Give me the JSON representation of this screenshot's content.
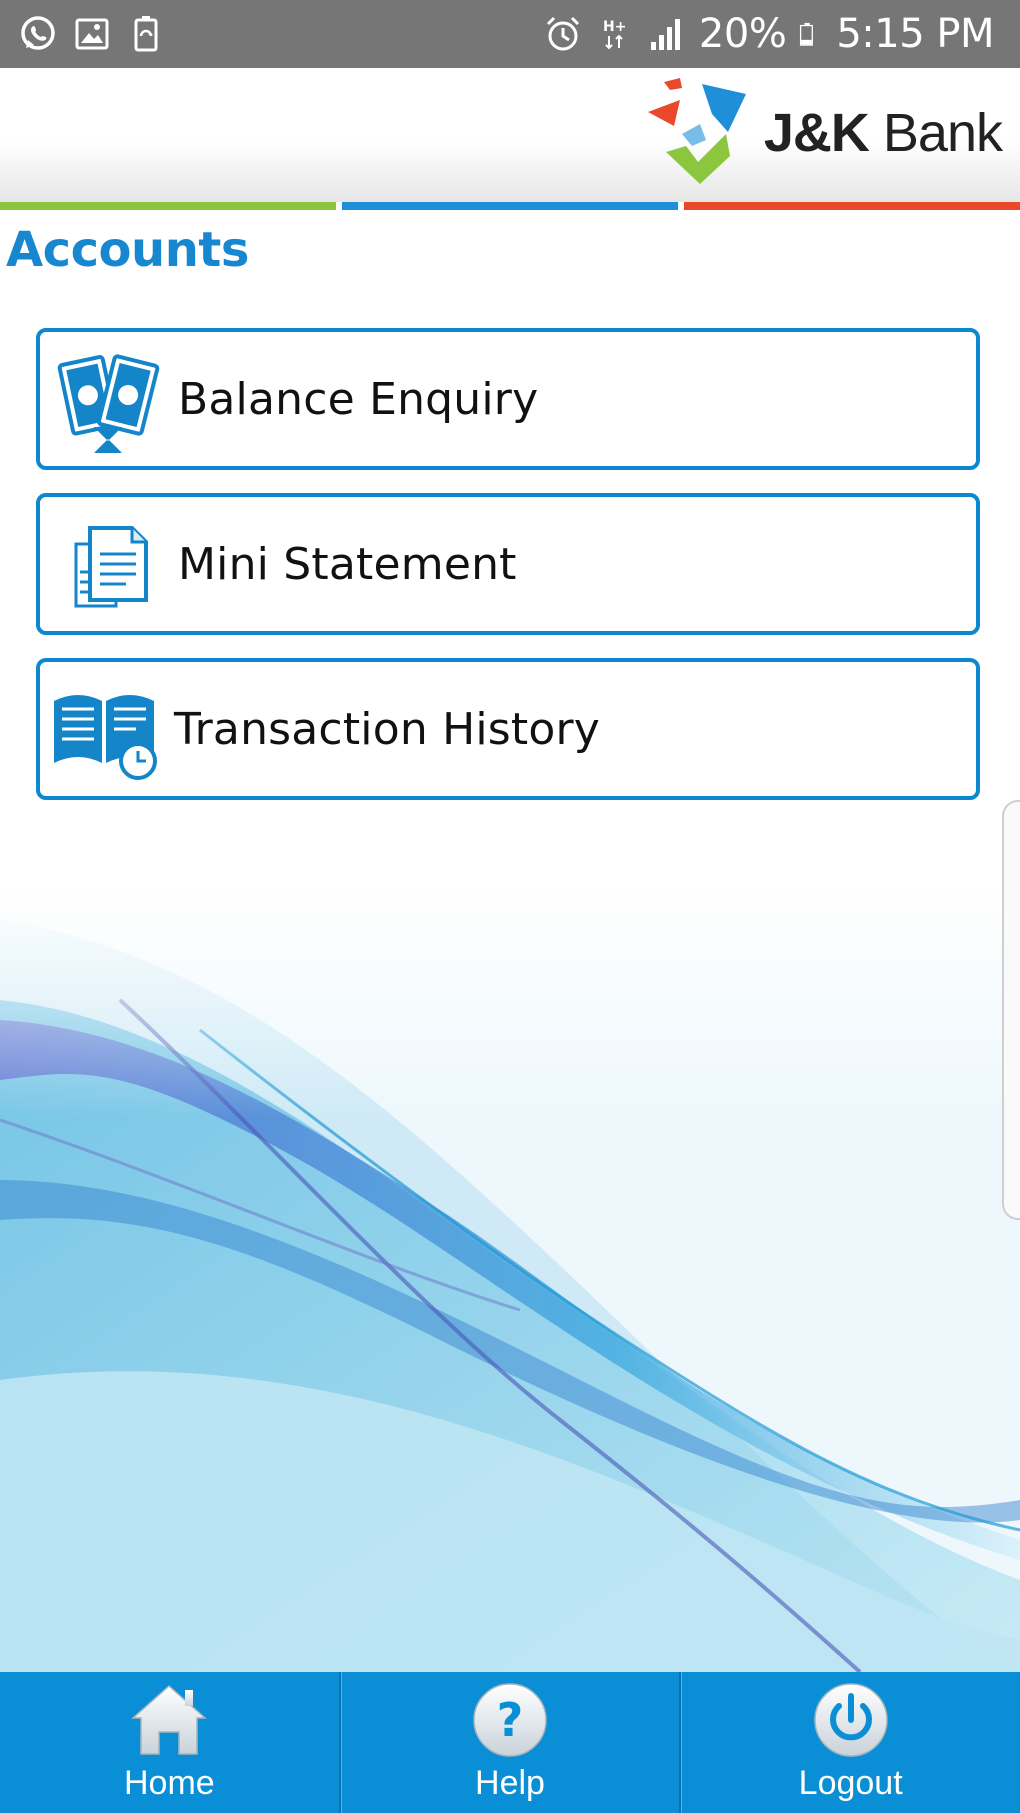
{
  "status_bar": {
    "battery": "20%",
    "time": "5:15 PM",
    "icons": [
      "whatsapp-icon",
      "gallery-icon",
      "battery-saver-icon",
      "alarm-icon",
      "hplus-network-icon",
      "signal-icon",
      "battery-icon"
    ]
  },
  "header": {
    "brand_bold": "J&K",
    "brand_light": " Bank",
    "stripe_colors": [
      "#8cc63f",
      "#1e8fd8",
      "#e9482b"
    ]
  },
  "page": {
    "title": "Accounts"
  },
  "menu": {
    "items": [
      {
        "label": "Balance Enquiry",
        "icon": "money-balance-icon"
      },
      {
        "label": "Mini Statement",
        "icon": "document-icon"
      },
      {
        "label": "Transaction History",
        "icon": "book-clock-icon"
      }
    ]
  },
  "bottom_nav": {
    "items": [
      {
        "label": "Home",
        "icon": "home-icon"
      },
      {
        "label": "Help",
        "icon": "help-icon"
      },
      {
        "label": "Logout",
        "icon": "power-icon"
      }
    ]
  },
  "colors": {
    "accent": "#0d87cf",
    "nav_bg": "#0a8fd6",
    "status_bg": "#767676"
  }
}
